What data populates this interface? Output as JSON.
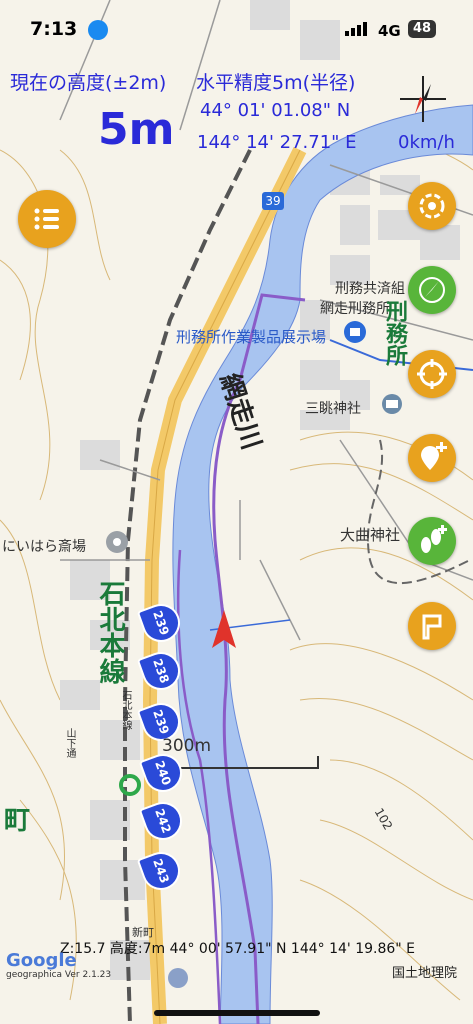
{
  "status_bar": {
    "time": "7:13",
    "network": "4G",
    "battery": "48"
  },
  "hud": {
    "altitude_label": "現在の高度(±2m)",
    "accuracy_label": "水平精度5m(半径)",
    "altitude_value": "5m",
    "latitude": "44° 01' 01.08\" N",
    "longitude": "144° 14' 27.71\" E",
    "speed": "0km/h"
  },
  "map_labels": {
    "river": "網走川",
    "railway": "石北本線",
    "exhibition_hall": "刑務所作業製品展示場",
    "mutual_aid": "刑務共済組",
    "abashiri_prison": "網走刑務所",
    "shrine_sancho": "三眺神社",
    "shrine_omagari": "大曲神社",
    "funeral_hall": "にいはら斎場",
    "road_39": "39",
    "kp_markers": [
      "239",
      "238",
      "239",
      "240",
      "242",
      "243"
    ],
    "scale": "300m",
    "prison_vertical": "刑務所",
    "bottom_left_char": "町",
    "street_label_1": "石北本線",
    "street_label_2": "山下通",
    "district": "新町",
    "elev_102": "102"
  },
  "bottom": {
    "coords": "Z:15.7 高度:7m  44° 00' 57.91\" N 144° 14' 19.86\" E",
    "credit": "国土地理院",
    "logo": "Google",
    "version": "geographica Ver 2.1.23"
  },
  "colors": {
    "hud_text": "#2a2ad8",
    "orange_button": "#e8a21e",
    "green_button": "#58b53a",
    "river": "#a8c4f0"
  },
  "icons": [
    "menu-icon",
    "compass-icon",
    "spiral-icon",
    "locate-icon",
    "add-pin-icon",
    "footprints-icon",
    "flag-icon",
    "location-arrow-icon"
  ]
}
